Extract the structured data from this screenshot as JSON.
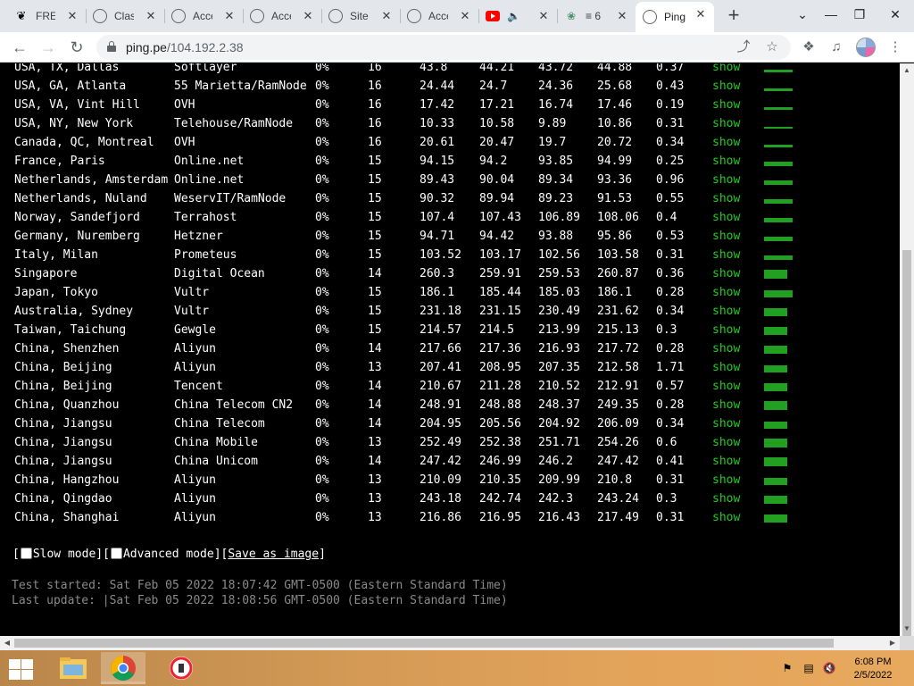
{
  "tabs": [
    {
      "title": "FREE",
      "icon": "heist-icon"
    },
    {
      "title": "Clash",
      "icon": "globe-icon"
    },
    {
      "title": "Access",
      "icon": "globe-icon"
    },
    {
      "title": "Access",
      "icon": "globe-icon"
    },
    {
      "title": "Site",
      "icon": "globe-icon"
    },
    {
      "title": "Access",
      "icon": "globe-icon"
    },
    {
      "title": "",
      "icon": "youtube-icon"
    },
    {
      "title": "≡ 6",
      "icon": "extension-icon"
    },
    {
      "title": "Ping",
      "icon": "globe-icon",
      "active": true
    }
  ],
  "address_bar": {
    "host": "ping.pe",
    "path": "/104.192.2.38"
  },
  "rows": [
    {
      "location": "USA, TX, Dallas",
      "provider": "Softlayer",
      "loss": "0%",
      "count": "16",
      "last": "43.8",
      "avg": "44.21",
      "best": "43.72",
      "worst": "44.88",
      "stdev": "0.37",
      "action": "show"
    },
    {
      "location": "USA, GA, Atlanta",
      "provider": "55 Marietta/RamNode",
      "loss": "0%",
      "count": "16",
      "last": "24.44",
      "avg": "24.7",
      "best": "24.36",
      "worst": "25.68",
      "stdev": "0.43",
      "action": "show"
    },
    {
      "location": "USA, VA, Vint Hill",
      "provider": "OVH",
      "loss": "0%",
      "count": "16",
      "last": "17.42",
      "avg": "17.21",
      "best": "16.74",
      "worst": "17.46",
      "stdev": "0.19",
      "action": "show"
    },
    {
      "location": "USA, NY, New York",
      "provider": "Telehouse/RamNode",
      "loss": "0%",
      "count": "16",
      "last": "10.33",
      "avg": "10.58",
      "best": "9.89",
      "worst": "10.86",
      "stdev": "0.31",
      "action": "show"
    },
    {
      "location": "Canada, QC, Montreal",
      "provider": "OVH",
      "loss": "0%",
      "count": "16",
      "last": "20.61",
      "avg": "20.47",
      "best": "19.7",
      "worst": "20.72",
      "stdev": "0.34",
      "action": "show"
    },
    {
      "location": "France, Paris",
      "provider": "Online.net",
      "loss": "0%",
      "count": "15",
      "last": "94.15",
      "avg": "94.2",
      "best": "93.85",
      "worst": "94.99",
      "stdev": "0.25",
      "action": "show"
    },
    {
      "location": "Netherlands, Amsterdam",
      "provider": "Online.net",
      "loss": "0%",
      "count": "15",
      "last": "89.43",
      "avg": "90.04",
      "best": "89.34",
      "worst": "93.36",
      "stdev": "0.96",
      "action": "show"
    },
    {
      "location": "Netherlands, Nuland",
      "provider": "WeservIT/RamNode",
      "loss": "0%",
      "count": "15",
      "last": "90.32",
      "avg": "89.94",
      "best": "89.23",
      "worst": "91.53",
      "stdev": "0.55",
      "action": "show"
    },
    {
      "location": "Norway, Sandefjord",
      "provider": "Terrahost",
      "loss": "0%",
      "count": "15",
      "last": "107.4",
      "avg": "107.43",
      "best": "106.89",
      "worst": "108.06",
      "stdev": "0.4",
      "action": "show"
    },
    {
      "location": "Germany, Nuremberg",
      "provider": "Hetzner",
      "loss": "0%",
      "count": "15",
      "last": "94.71",
      "avg": "94.42",
      "best": "93.88",
      "worst": "95.86",
      "stdev": "0.53",
      "action": "show"
    },
    {
      "location": "Italy, Milan",
      "provider": "Prometeus",
      "loss": "0%",
      "count": "15",
      "last": "103.52",
      "avg": "103.17",
      "best": "102.56",
      "worst": "103.58",
      "stdev": "0.31",
      "action": "show"
    },
    {
      "location": "Singapore",
      "provider": "Digital Ocean",
      "loss": "0%",
      "count": "14",
      "last": "260.3",
      "avg": "259.91",
      "best": "259.53",
      "worst": "260.87",
      "stdev": "0.36",
      "action": "show"
    },
    {
      "location": "Japan, Tokyo",
      "provider": "Vultr",
      "loss": "0%",
      "count": "15",
      "last": "186.1",
      "avg": "185.44",
      "best": "185.03",
      "worst": "186.1",
      "stdev": "0.28",
      "action": "show"
    },
    {
      "location": "Australia, Sydney",
      "provider": "Vultr",
      "loss": "0%",
      "count": "15",
      "last": "231.18",
      "avg": "231.15",
      "best": "230.49",
      "worst": "231.62",
      "stdev": "0.34",
      "action": "show"
    },
    {
      "location": "Taiwan, Taichung",
      "provider": "Gewgle",
      "loss": "0%",
      "count": "15",
      "last": "214.57",
      "avg": "214.5",
      "best": "213.99",
      "worst": "215.13",
      "stdev": "0.3",
      "action": "show"
    },
    {
      "location": "China, Shenzhen",
      "provider": "Aliyun",
      "loss": "0%",
      "count": "14",
      "last": "217.66",
      "avg": "217.36",
      "best": "216.93",
      "worst": "217.72",
      "stdev": "0.28",
      "action": "show"
    },
    {
      "location": "China, Beijing",
      "provider": "Aliyun",
      "loss": "0%",
      "count": "13",
      "last": "207.41",
      "avg": "208.95",
      "best": "207.35",
      "worst": "212.58",
      "stdev": "1.71",
      "action": "show"
    },
    {
      "location": "China, Beijing",
      "provider": "Tencent",
      "loss": "0%",
      "count": "14",
      "last": "210.67",
      "avg": "211.28",
      "best": "210.52",
      "worst": "212.91",
      "stdev": "0.57",
      "action": "show"
    },
    {
      "location": "China, Quanzhou",
      "provider": "China Telecom CN2",
      "loss": "0%",
      "count": "14",
      "last": "248.91",
      "avg": "248.88",
      "best": "248.37",
      "worst": "249.35",
      "stdev": "0.28",
      "action": "show"
    },
    {
      "location": "China, Jiangsu",
      "provider": "China Telecom",
      "loss": "0%",
      "count": "14",
      "last": "204.95",
      "avg": "205.56",
      "best": "204.92",
      "worst": "206.09",
      "stdev": "0.34",
      "action": "show"
    },
    {
      "location": "China, Jiangsu",
      "provider": "China Mobile",
      "loss": "0%",
      "count": "13",
      "last": "252.49",
      "avg": "252.38",
      "best": "251.71",
      "worst": "254.26",
      "stdev": "0.6",
      "action": "show"
    },
    {
      "location": "China, Jiangsu",
      "provider": "China Unicom",
      "loss": "0%",
      "count": "14",
      "last": "247.42",
      "avg": "246.99",
      "best": "246.2",
      "worst": "247.42",
      "stdev": "0.41",
      "action": "show"
    },
    {
      "location": "China, Hangzhou",
      "provider": "Aliyun",
      "loss": "0%",
      "count": "13",
      "last": "210.09",
      "avg": "210.35",
      "best": "209.99",
      "worst": "210.8",
      "stdev": "0.31",
      "action": "show"
    },
    {
      "location": "China, Qingdao",
      "provider": "Aliyun",
      "loss": "0%",
      "count": "13",
      "last": "243.18",
      "avg": "242.74",
      "best": "242.3",
      "worst": "243.24",
      "stdev": "0.3",
      "action": "show"
    },
    {
      "location": "China, Shanghai",
      "provider": "Aliyun",
      "loss": "0%",
      "count": "13",
      "last": "216.86",
      "avg": "216.95",
      "best": "216.43",
      "worst": "217.49",
      "stdev": "0.31",
      "action": "show"
    }
  ],
  "options": {
    "slow_mode": "Slow mode",
    "advanced_mode": "Advanced mode",
    "save_as_image": "Save as image"
  },
  "status": {
    "test_started": "Test started: Sat Feb 05 2022 18:07:42 GMT-0500 (Eastern Standard Time)",
    "last_update": "Last update: |Sat Feb 05 2022 18:08:56 GMT-0500 (Eastern Standard Time)"
  },
  "taskbar": {
    "time": "6:08 PM",
    "date": "2/5/2022"
  },
  "colors": {
    "show_link": "#22cc22",
    "sparkline": "#22a022",
    "background": "#000000"
  }
}
